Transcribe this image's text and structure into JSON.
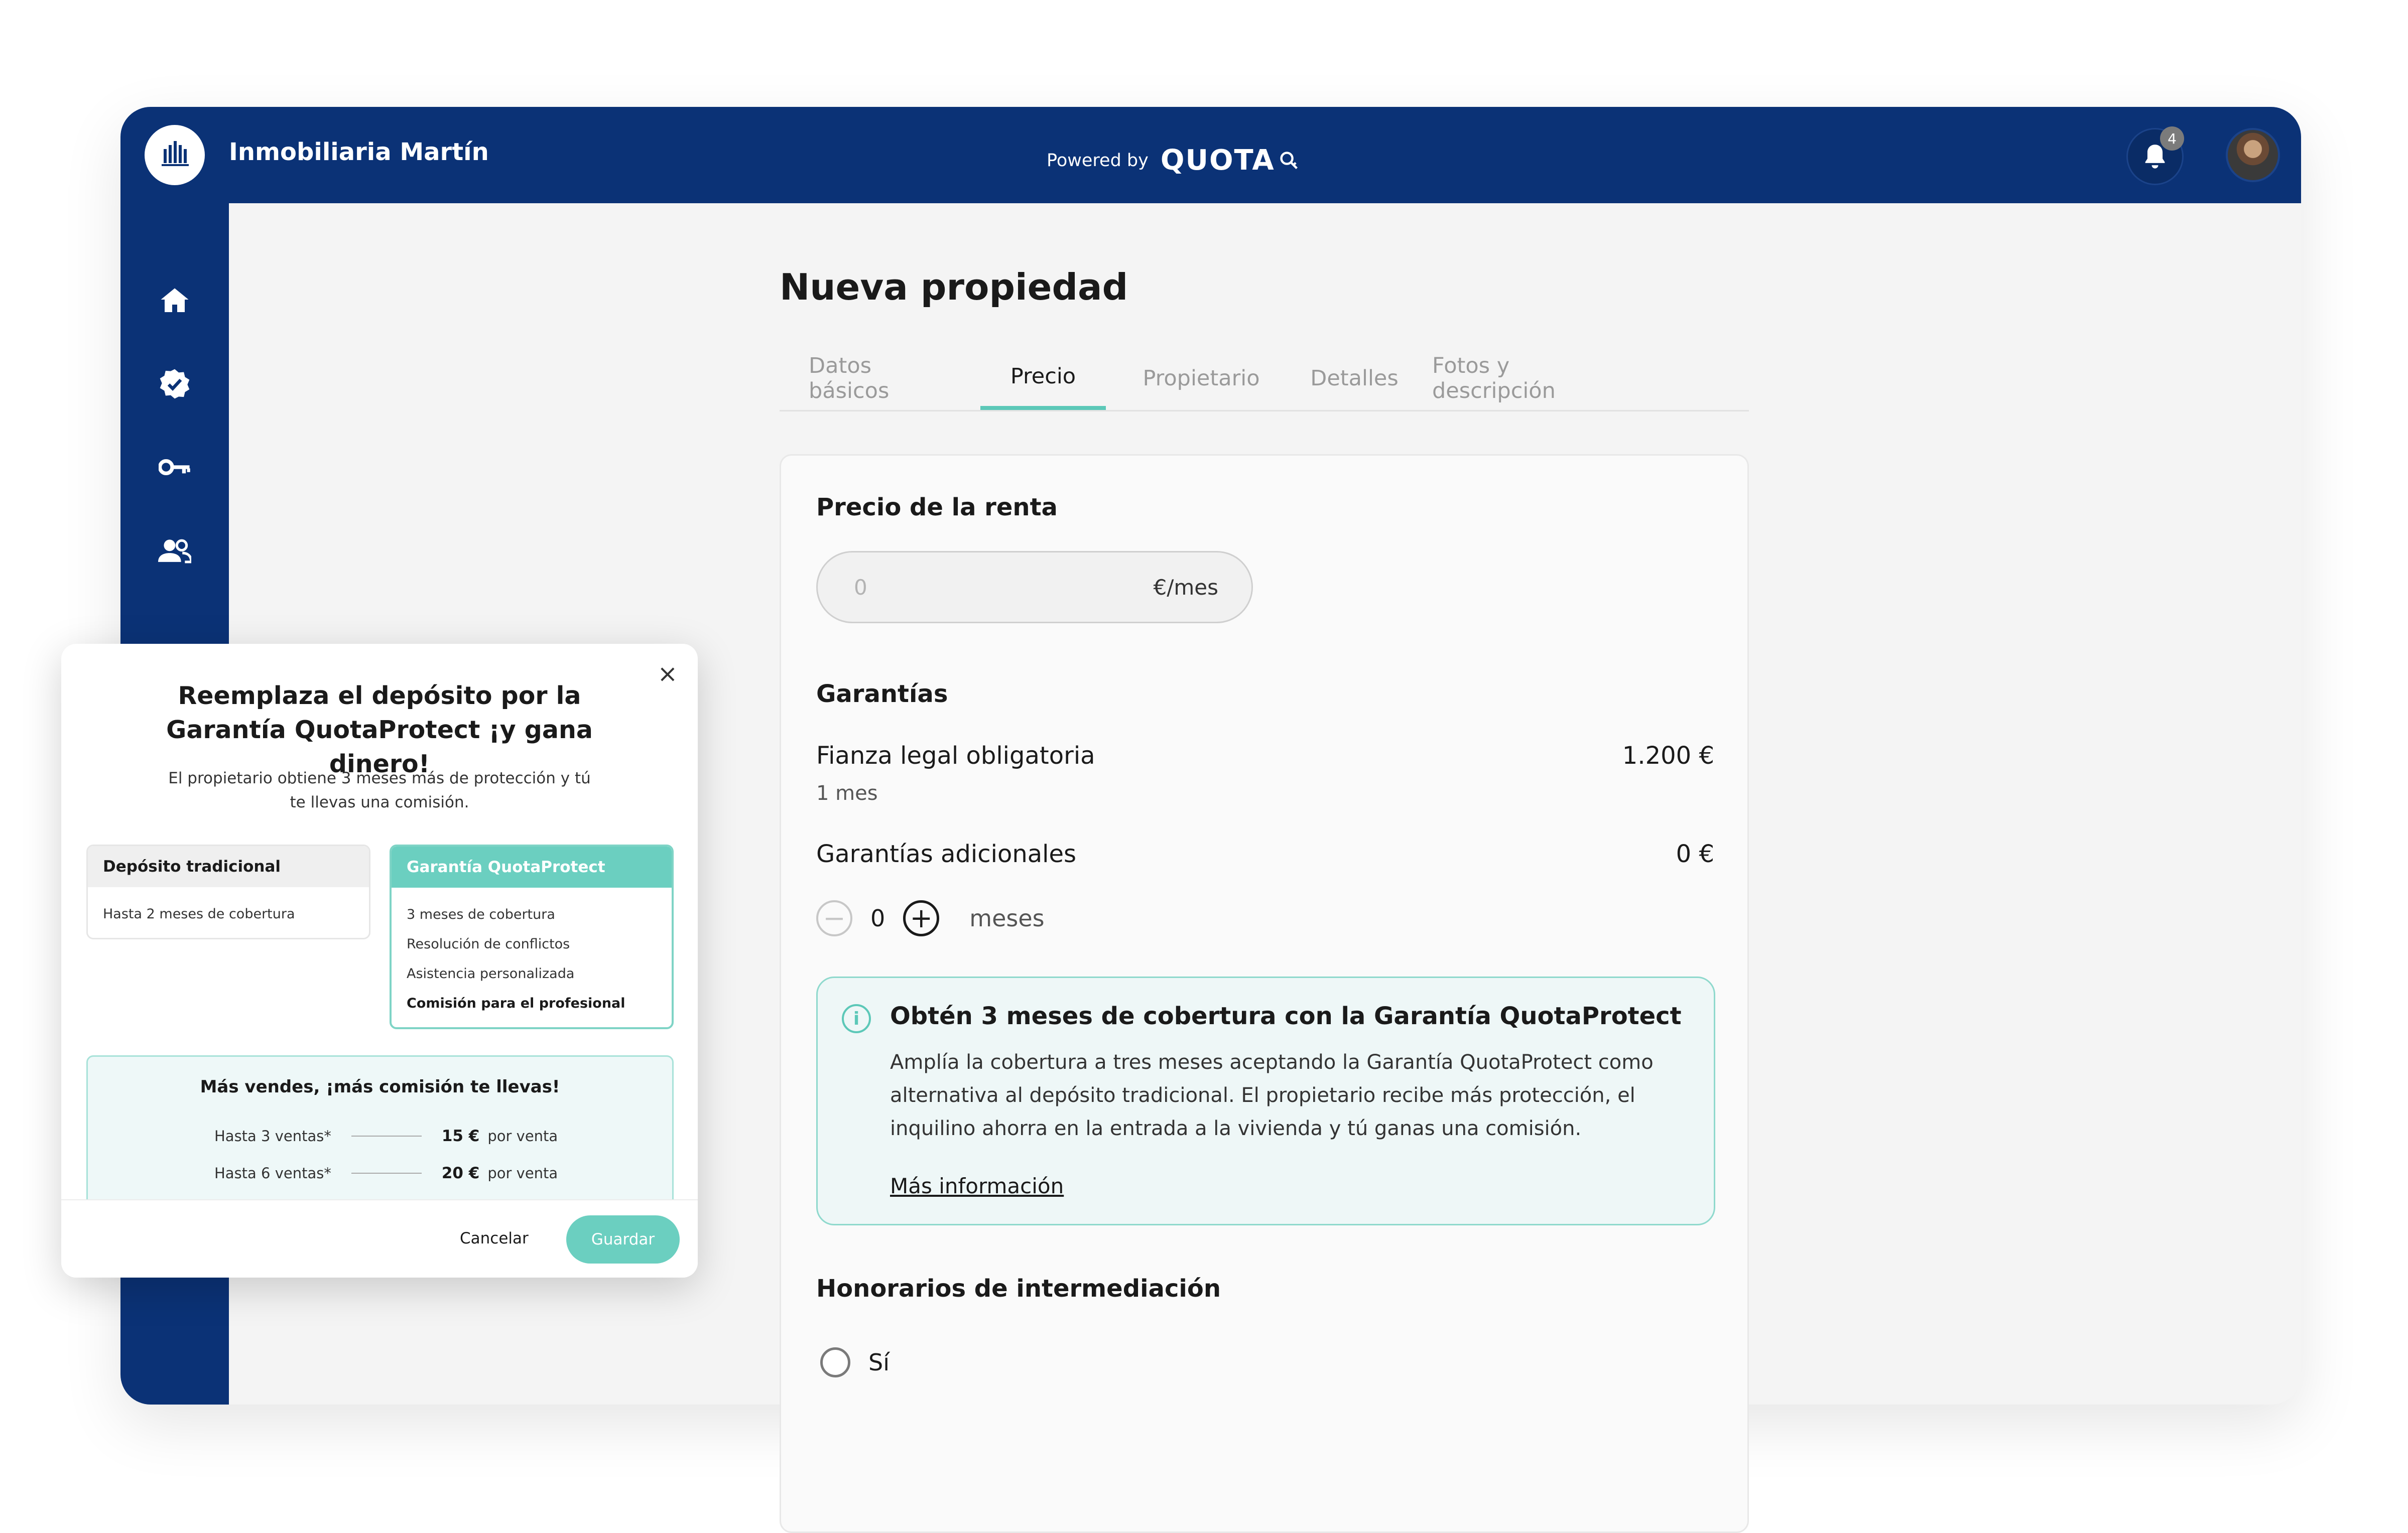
{
  "header": {
    "brand": "Inmobiliaria Martín",
    "powered_by": "Powered by",
    "powered_logo": "QUOTA",
    "notifications_count": "4",
    "colors": {
      "primary": "#0b3276",
      "accent": "#5cc8b8"
    }
  },
  "sidebar": {
    "items": [
      {
        "icon": "home-icon"
      },
      {
        "icon": "verified-badge-icon"
      },
      {
        "icon": "key-icon"
      },
      {
        "icon": "people-icon"
      },
      {
        "icon": "building-icon",
        "active": true
      }
    ]
  },
  "page": {
    "title": "Nueva propiedad",
    "tabs": [
      {
        "label": "Datos básicos"
      },
      {
        "label": "Precio",
        "active": true
      },
      {
        "label": "Propietario"
      },
      {
        "label": "Detalles"
      },
      {
        "label": "Fotos y descripción"
      }
    ]
  },
  "price": {
    "heading": "Precio de la renta",
    "value": "0",
    "unit": "€/mes"
  },
  "guarantees": {
    "heading": "Garantías",
    "legal_label": "Fianza legal obligatoria",
    "legal_sub": "1 mes",
    "legal_value": "1.200 €",
    "additional_label": "Garantías adicionales",
    "additional_value": "0 €",
    "months_count": "0",
    "months_unit": "meses"
  },
  "info": {
    "title": "Obtén 3 meses de cobertura con la Garantía QuotaProtect",
    "text": "Amplía la cobertura a tres meses aceptando la Garantía QuotaProtect como alternativa al depósito tradicional. El propietario recibe más protección, el inquilino ahorra en la entrada a la vivienda y tú ganas una comisión.",
    "link": "Más información"
  },
  "fees": {
    "heading": "Honorarios de intermediación",
    "option_yes": "Sí"
  },
  "modal": {
    "close": "×",
    "title": "Reemplaza el depósito por la Garantía QuotaProtect ¡y gana dinero!",
    "subtitle": "El propietario obtiene 3 meses más de protección y tú te llevas una comisión.",
    "traditional": {
      "title": "Depósito tradicional",
      "items": [
        "Hasta 2 meses de cobertura"
      ]
    },
    "quotaprotect": {
      "title": "Garantía QuotaProtect",
      "items": [
        "3 meses de cobertura",
        "Resolución de conflictos",
        "Asistencia personalizada",
        "Comisión para el profesional"
      ]
    },
    "commission": {
      "title": "Más vendes, ¡más comisión te llevas!",
      "tiers": [
        {
          "label": "Hasta 3 ventas*",
          "amount": "15 €",
          "unit": "por venta"
        },
        {
          "label": "Hasta 6 ventas*",
          "amount": "20 €",
          "unit": "por venta"
        }
      ]
    },
    "cancel": "Cancelar",
    "save": "Guardar"
  }
}
